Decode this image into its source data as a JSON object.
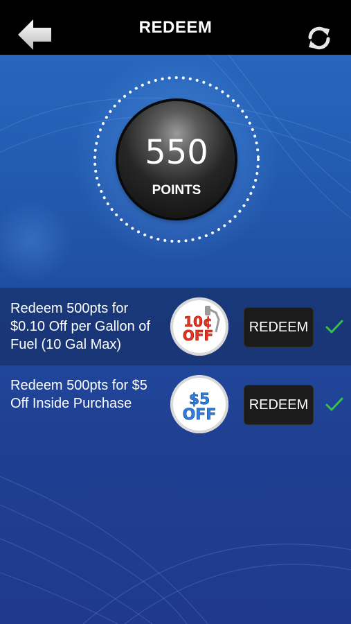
{
  "header": {
    "title": "REDEEM",
    "back_icon": "arrow-left-icon",
    "refresh_icon": "refresh-icon"
  },
  "points": {
    "value": "550",
    "label": "POINTS"
  },
  "offers": [
    {
      "description": "Redeem 500pts for $0.10 Off per Gallon of Fuel (10 Gal Max)",
      "badge_line1": "10¢",
      "badge_line2": "OFF",
      "badge_color": "#e8321e",
      "button_label": "REDEEM",
      "available": true
    },
    {
      "description": "Redeem 500pts for $5 Off Inside Purchase",
      "badge_line1": "$5",
      "badge_line2": "OFF",
      "badge_color": "#2f7fe0",
      "button_label": "REDEEM",
      "available": true
    }
  ],
  "colors": {
    "header_bg": "#000000",
    "check": "#34c24a",
    "background_top": "#2a6bc0",
    "background_bottom": "#1f3a8c"
  }
}
